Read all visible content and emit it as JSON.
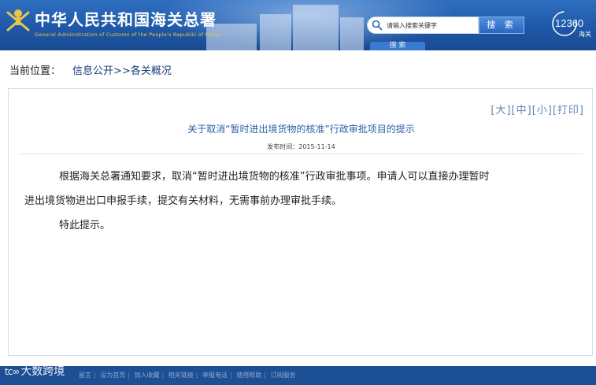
{
  "header": {
    "title": "中华人民共和国海关总署",
    "subtitle": "General Administration of Customs of the People's Republic of China",
    "search_placeholder": "请输入搜索关键字",
    "search_button": "搜 索",
    "search_tab": "搜 索",
    "hotline_number": "12360",
    "hotline_label": "海关"
  },
  "breadcrumb": {
    "label": "当前位置：",
    "path": [
      "信息公开",
      ">>",
      "各关概况"
    ]
  },
  "font_controls": {
    "large": "[大]",
    "medium": "[中]",
    "small": "[小]",
    "print": "[打印]"
  },
  "article": {
    "title": "关于取消“暂时进出境货物的核准”行政审批项目的提示",
    "date": "发布时间：2015-11-14",
    "paragraph_1_line_1": "根据海关总署通知要求，取消“暂时进出境货物的核准”行政审批事项。申请人可以直接办理暂时",
    "paragraph_1_line_2": "进出境货物进出口申报手续，提交有关材料，无需事前办理审批手续。",
    "paragraph_2": "特此提示。"
  },
  "footer": {
    "links": [
      "留言",
      "设为首页",
      "加入收藏",
      "相关链接",
      "举报电话",
      "使用帮助",
      "订阅服务"
    ]
  },
  "watermark": {
    "mark": "tc∞",
    "text": "大数跨境"
  },
  "colors": {
    "header_blue": "#1f58a8",
    "title_blue": "#2d5fa6",
    "footer_blue": "#1d4f95",
    "emblem_gold": "#e8c64a"
  }
}
